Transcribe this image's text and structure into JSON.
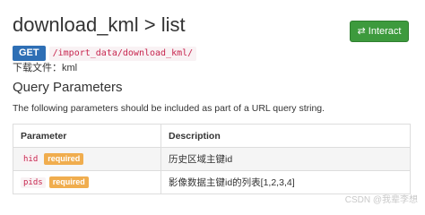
{
  "header": {
    "title": "download_kml > list",
    "interact_label": "Interact",
    "interact_icon": "swap-arrows-icon"
  },
  "endpoint": {
    "method": "GET",
    "path": "/import_data/download_kml/",
    "download_line": "下载文件：kml"
  },
  "query": {
    "heading": "Query Parameters",
    "description": "The following parameters should be included as part of a URL query string."
  },
  "table": {
    "headers": [
      "Parameter",
      "Description"
    ],
    "rows": [
      {
        "name": "hid",
        "badge": "required",
        "description": "历史区域主键id"
      },
      {
        "name": "pids",
        "badge": "required",
        "description": "影像数据主键id的列表[1,2,3,4]"
      }
    ]
  },
  "watermark": "CSDN @我辈李想",
  "colors": {
    "interact_button": "#3d9a3d",
    "method_badge": "#2e6fb5",
    "required_badge": "#f0ad4e",
    "code_text": "#c7254e"
  }
}
